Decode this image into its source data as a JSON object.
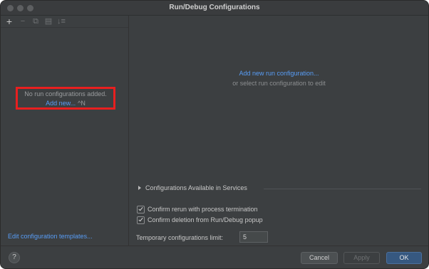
{
  "window": {
    "title": "Run/Debug Configurations"
  },
  "toolbar": {
    "add_icon": "+",
    "remove_icon": "−",
    "copy_icon": "⧉",
    "folder_icon": "▤",
    "sort_icon": "↓≡"
  },
  "left": {
    "empty_text": "No run configurations added.",
    "add_new_label": "Add new...",
    "add_new_shortcut": "^N",
    "edit_templates_label": "Edit configuration templates..."
  },
  "right": {
    "add_config_link": "Add new run configuration...",
    "select_hint": "or select run configuration to edit",
    "services_label": "Configurations Available in Services",
    "confirm_rerun_label": "Confirm rerun with process termination",
    "confirm_rerun_checked": true,
    "confirm_delete_label": "Confirm deletion from Run/Debug popup",
    "confirm_delete_checked": true,
    "limit_label": "Temporary configurations limit:",
    "limit_value": "5"
  },
  "footer": {
    "help_label": "?",
    "cancel_label": "Cancel",
    "apply_label": "Apply",
    "ok_label": "OK"
  },
  "colors": {
    "link": "#589df6",
    "highlight_box": "#e81f1f",
    "primary_button": "#365880",
    "background": "#3c3f41"
  }
}
